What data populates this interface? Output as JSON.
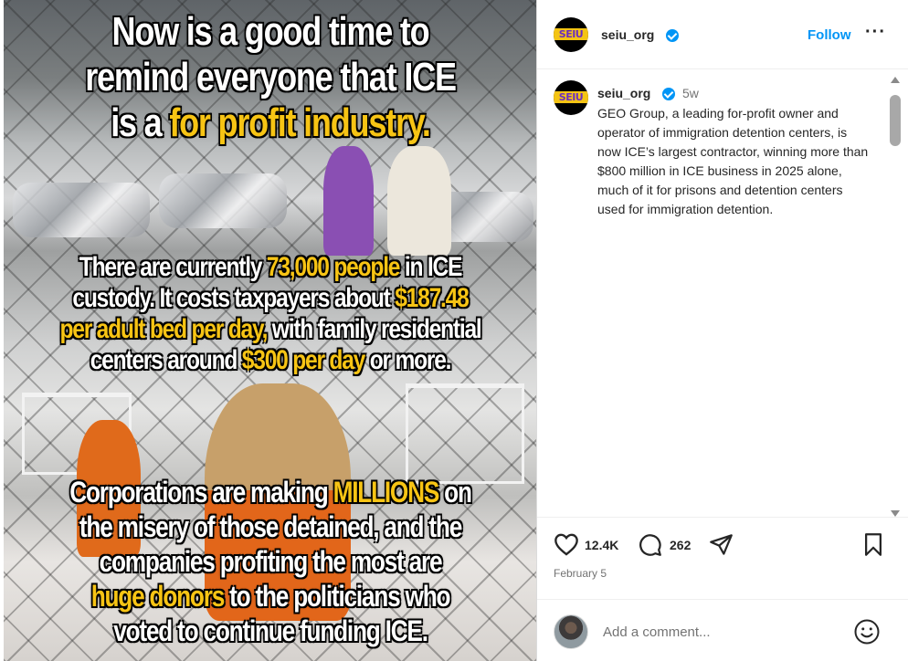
{
  "media": {
    "line1": "Now is a good time to",
    "line2": "remind everyone that ICE",
    "line3_a": "is a ",
    "line3_hl": "for profit industry.",
    "p2_a": "There are currently ",
    "p2_hl1": "73,000 people",
    "p2_b": " in ICE",
    "p2_c": "custody. It costs taxpayers about ",
    "p2_hl2": "$187.48",
    "p2_hl3": "per adult bed per day,",
    "p2_d": " with family residential",
    "p2_e": "centers around ",
    "p2_hl4": "$300 per day",
    "p2_f": " or more.",
    "p3_a": "Corporations are making ",
    "p3_hl1": "MILLIONS",
    "p3_b": " on",
    "p3_c": "the misery of those detained, and the",
    "p3_d": "companies profiting the most are",
    "p3_hl2": "huge donors",
    "p3_e": " to the politicians who",
    "p3_f": "voted to continue funding ICE.",
    "highlight_color": "#f7c414"
  },
  "header": {
    "avatar_logo": "SEIU",
    "username": "seiu_org",
    "verified_icon": "verified-badge-icon",
    "follow_label": "Follow",
    "more_label": "···"
  },
  "post": {
    "avatar_logo": "SEIU",
    "username": "seiu_org",
    "time_ago": "5w",
    "caption": "GEO Group, a leading for-profit owner and operator of immigration detention centers, is now ICE’s largest contractor, winning more than $800 million in ICE business in 2025 alone, much of it for prisons and detention centers used for immigration detention."
  },
  "actions": {
    "like_icon": "heart-icon",
    "likes": "12.4K",
    "comment_icon": "comment-icon",
    "comments": "262",
    "share_icon": "send-icon",
    "save_icon": "bookmark-icon",
    "date": "February 5"
  },
  "comment_box": {
    "placeholder": "Add a comment...",
    "emoji_icon": "emoji-icon"
  },
  "colors": {
    "link": "#0095f6",
    "text": "#262626",
    "muted": "#737373"
  }
}
